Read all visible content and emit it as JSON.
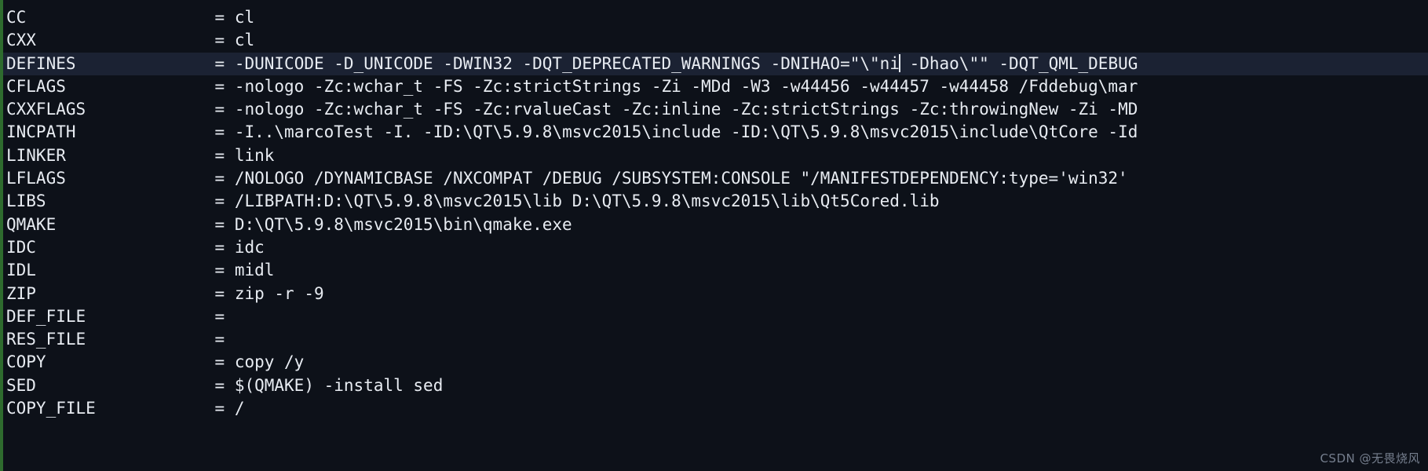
{
  "terminal": {
    "background_color": "#0d1119",
    "text_color": "#e8ecf2",
    "highlight_color": "#1b2233",
    "left_border_color": "#2e6b2e",
    "cursor_visible": true,
    "cursor_line_index": 2,
    "lines": [
      {
        "name": "CC",
        "eq": "=",
        "value": "cl",
        "highlight": false
      },
      {
        "name": "CXX",
        "eq": "=",
        "value": "cl",
        "highlight": false
      },
      {
        "name": "DEFINES",
        "eq": "=",
        "value_before_cursor": "-DUNICODE -D_UNICODE -DWIN32 -DQT_DEPRECATED_WARNINGS -DNIHAO=\"\\\"ni",
        "value_after_cursor": " -Dhao\\\"\" -DQT_QML_DEBUG",
        "value": "-DUNICODE -D_UNICODE -DWIN32 -DQT_DEPRECATED_WARNINGS -DNIHAO=\"\\\"ni -Dhao\\\"\" -DQT_QML_DEBUG",
        "highlight": true
      },
      {
        "name": "CFLAGS",
        "eq": "=",
        "value": "-nologo -Zc:wchar_t -FS -Zc:strictStrings -Zi -MDd -W3 -w44456 -w44457 -w44458 /Fddebug\\mar",
        "highlight": false
      },
      {
        "name": "CXXFLAGS",
        "eq": "=",
        "value": "-nologo -Zc:wchar_t -FS -Zc:rvalueCast -Zc:inline -Zc:strictStrings -Zc:throwingNew -Zi -MD",
        "highlight": false
      },
      {
        "name": "INCPATH",
        "eq": "=",
        "value": "-I..\\marcoTest -I. -ID:\\QT\\5.9.8\\msvc2015\\include -ID:\\QT\\5.9.8\\msvc2015\\include\\QtCore -Id",
        "highlight": false
      },
      {
        "name": "LINKER",
        "eq": "=",
        "value": "link",
        "highlight": false
      },
      {
        "name": "LFLAGS",
        "eq": "=",
        "value": "/NOLOGO /DYNAMICBASE /NXCOMPAT /DEBUG /SUBSYSTEM:CONSOLE \"/MANIFESTDEPENDENCY:type='win32'",
        "highlight": false
      },
      {
        "name": "LIBS",
        "eq": "=",
        "value": "/LIBPATH:D:\\QT\\5.9.8\\msvc2015\\lib D:\\QT\\5.9.8\\msvc2015\\lib\\Qt5Cored.lib",
        "highlight": false
      },
      {
        "name": "QMAKE",
        "eq": "=",
        "value": "D:\\QT\\5.9.8\\msvc2015\\bin\\qmake.exe",
        "highlight": false
      },
      {
        "name": "IDC",
        "eq": "=",
        "value": "idc",
        "highlight": false
      },
      {
        "name": "IDL",
        "eq": "=",
        "value": "midl",
        "highlight": false
      },
      {
        "name": "ZIP",
        "eq": "=",
        "value": "zip -r -9",
        "highlight": false
      },
      {
        "name": "DEF_FILE",
        "eq": "=",
        "value": "",
        "highlight": false
      },
      {
        "name": "RES_FILE",
        "eq": "=",
        "value": "",
        "highlight": false
      },
      {
        "name": "COPY",
        "eq": "=",
        "value": "copy /y",
        "highlight": false
      },
      {
        "name": "SED",
        "eq": "=",
        "value": "$(QMAKE) -install sed",
        "highlight": false
      },
      {
        "name": "COPY_FILE",
        "eq": "=",
        "value": "/",
        "highlight": false
      }
    ]
  },
  "watermark": {
    "text": "CSDN @无畏烧风"
  }
}
